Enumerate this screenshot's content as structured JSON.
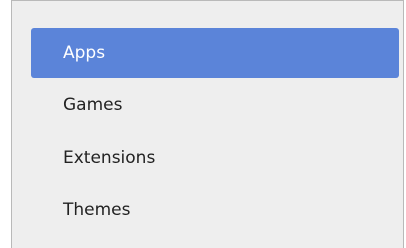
{
  "nav": {
    "items": [
      {
        "label": "Apps",
        "selected": true
      },
      {
        "label": "Games",
        "selected": false
      },
      {
        "label": "Extensions",
        "selected": false
      },
      {
        "label": "Themes",
        "selected": false
      }
    ]
  },
  "colors": {
    "selected_background": "#5b84d9",
    "panel_background": "#eeeeee"
  }
}
